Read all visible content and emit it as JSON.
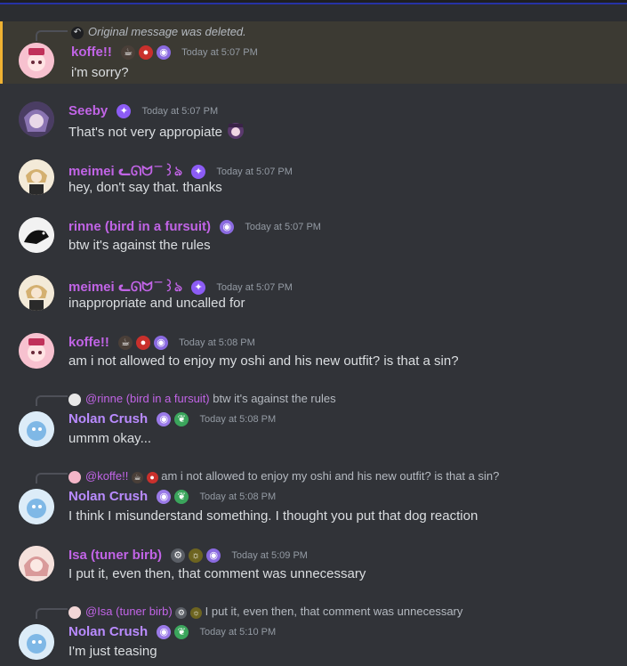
{
  "colors": {
    "bg": "#313338",
    "highlight": "#3c3a33",
    "accent": "#f0b232",
    "role_pink": "#c164e6",
    "role_purple": "#b98bff"
  },
  "messages": [
    {
      "reply_text": "Original message was deleted.",
      "author": "koffe!!",
      "time": "Today at 5:07 PM",
      "text": "i'm sorry?"
    },
    {
      "author": "Seeby",
      "time": "Today at 5:07 PM",
      "text": "That's not very appropiate"
    },
    {
      "author": "meimei ᓚᘏᗢ ̄ ̄ ꒱ঌ",
      "time": "Today at 5:07 PM",
      "text": "hey, don't say that. thanks"
    },
    {
      "author": "rinne (bird in a fursuit)",
      "time": "Today at 5:07 PM",
      "text": "btw it's against the rules"
    },
    {
      "author": "meimei ᓚᘏᗢ ̄ ̄ ꒱ঌ",
      "time": "Today at 5:07 PM",
      "text": "inappropriate and uncalled for"
    },
    {
      "author": "koffe!!",
      "time": "Today at 5:08 PM",
      "text": "am i not allowed to enjoy my oshi and his new outfit? is that a sin?"
    },
    {
      "reply_user": "@rinne (bird in a fursuit)",
      "reply_text": "btw it's against the rules",
      "author": "Nolan Crush",
      "time": "Today at 5:08 PM",
      "text": "ummm okay..."
    },
    {
      "reply_user": "@koffe!!",
      "reply_text": "am i not allowed to enjoy my oshi and his new outfit? is that a sin?",
      "author": "Nolan Crush",
      "time": "Today at 5:08 PM",
      "text": "I think I misunderstand something. I thought you put that dog reaction"
    },
    {
      "author": "Isa (tuner birb)",
      "time": "Today at 5:09 PM",
      "text": "I put it, even then, that comment was unnecessary"
    },
    {
      "reply_user": "@Isa (tuner birb)",
      "reply_text": "I put it, even then, that comment was unnecessary",
      "author": "Nolan Crush",
      "time": "Today at 5:10 PM",
      "text": "I'm just teasing"
    }
  ]
}
